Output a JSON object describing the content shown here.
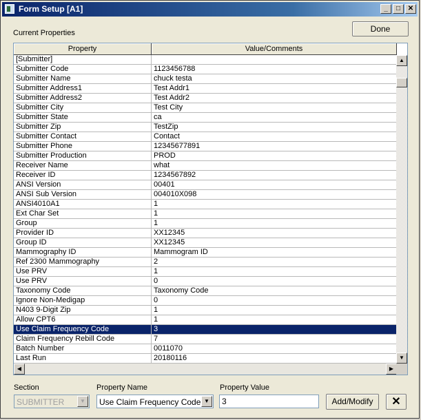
{
  "window": {
    "title": "Form Setup [A1]",
    "minimize_glyph": "_",
    "maximize_glyph": "□",
    "close_glyph": "✕"
  },
  "current_properties_label": "Current Properties",
  "done_label": "Done",
  "grid": {
    "columns": [
      "Property",
      "Value/Comments"
    ],
    "rows": [
      {
        "property": "[Submitter]",
        "value": ""
      },
      {
        "property": "Submitter Code",
        "value": "1123456788"
      },
      {
        "property": "Submitter Name",
        "value": "chuck testa"
      },
      {
        "property": "Submitter Address1",
        "value": "Test Addr1"
      },
      {
        "property": "Submitter Address2",
        "value": "Test Addr2"
      },
      {
        "property": "Submitter City",
        "value": "Test City"
      },
      {
        "property": "Submitter State",
        "value": "ca"
      },
      {
        "property": "Submitter Zip",
        "value": "TestZip"
      },
      {
        "property": "Submitter Contact",
        "value": "Contact"
      },
      {
        "property": "Submitter Phone",
        "value": "12345677891"
      },
      {
        "property": "Submitter Production",
        "value": "PROD"
      },
      {
        "property": "Receiver Name",
        "value": "what"
      },
      {
        "property": "Receiver ID",
        "value": "1234567892"
      },
      {
        "property": "ANSI Version",
        "value": "00401"
      },
      {
        "property": "ANSI Sub Version",
        "value": "004010X098"
      },
      {
        "property": "ANSI4010A1",
        "value": "1"
      },
      {
        "property": "Ext Char Set",
        "value": "1"
      },
      {
        "property": "Group",
        "value": "1"
      },
      {
        "property": "Provider ID",
        "value": "XX12345"
      },
      {
        "property": "Group ID",
        "value": "XX12345"
      },
      {
        "property": "Mammography ID",
        "value": "Mammogram ID"
      },
      {
        "property": "Ref 2300 Mammography",
        "value": "2"
      },
      {
        "property": "Use PRV",
        "value": " 1"
      },
      {
        "property": "Use PRV",
        "value": "0"
      },
      {
        "property": "Taxonomy Code",
        "value": "Taxonomy Code"
      },
      {
        "property": "Ignore Non-Medigap",
        "value": "0"
      },
      {
        "property": "N403 9-Digit Zip",
        "value": "1"
      },
      {
        "property": "Allow CPT6",
        "value": "1"
      },
      {
        "property": "Use Claim Frequency Code",
        "value": "3",
        "selected": true
      },
      {
        "property": "Claim Frequency Rebill Code",
        "value": "7"
      },
      {
        "property": "Batch Number",
        "value": "0011070"
      },
      {
        "property": "Last Run",
        "value": "20180116"
      }
    ]
  },
  "section": {
    "label": "Section",
    "value": "SUBMITTER"
  },
  "property_name": {
    "label": "Property Name",
    "value": "Use Claim Frequency Code"
  },
  "property_value": {
    "label": "Property Value",
    "value": "3"
  },
  "add_modify_label": "Add/Modify",
  "delete_glyph": "✕"
}
